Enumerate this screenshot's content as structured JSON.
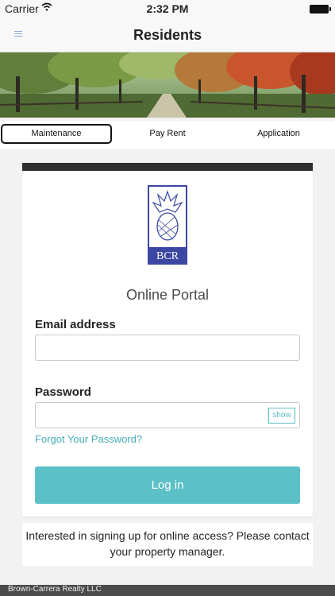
{
  "status_bar": {
    "carrier": "Carrier",
    "time": "2:32 PM"
  },
  "nav": {
    "title": "Residents"
  },
  "tabs": [
    {
      "label": "Maintenance",
      "selected": true
    },
    {
      "label": "Pay Rent",
      "selected": false
    },
    {
      "label": "Application",
      "selected": false
    }
  ],
  "login": {
    "logo_text": "BCR",
    "title": "Online Portal",
    "email_label": "Email address",
    "email_value": "",
    "password_label": "Password",
    "password_value": "",
    "show_label": "show",
    "forgot_label": "Forgot Your Password?",
    "login_label": "Log in"
  },
  "notice": "Interested in signing up for online access? Please contact your property manager.",
  "footer": {
    "text": "Brown-Carrera Realty LLC"
  },
  "colors": {
    "accent": "#5cc0c7",
    "link": "#45aeb8",
    "header_bar": "#2f2f2f",
    "logo_blue": "#3b47a2"
  },
  "icons": [
    "menu-icon",
    "wifi-icon",
    "battery-icon"
  ]
}
